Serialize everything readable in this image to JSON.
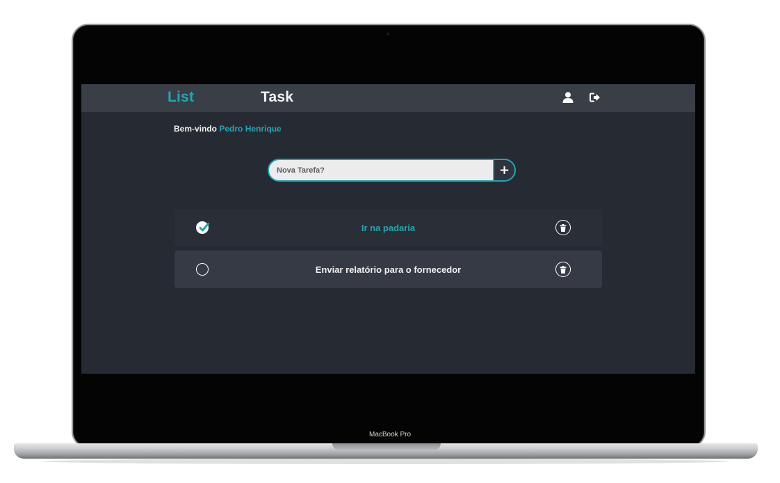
{
  "app": {
    "logo_primary": "Task",
    "logo_accent": "List",
    "accent_color": "#1ea8b4"
  },
  "header": {
    "icons": [
      "user-icon",
      "logout-icon"
    ]
  },
  "welcome": {
    "greeting": "Bem-vindo",
    "user_name": "Pedro Henrique"
  },
  "new_task": {
    "placeholder": "Nova Tarefa?",
    "value": "",
    "add_label": "+"
  },
  "tasks": [
    {
      "title": "Ir na padaria",
      "completed": true
    },
    {
      "title": "Enviar relatório para o fornecedor",
      "completed": false
    }
  ],
  "device": {
    "label": "MacBook Pro"
  }
}
